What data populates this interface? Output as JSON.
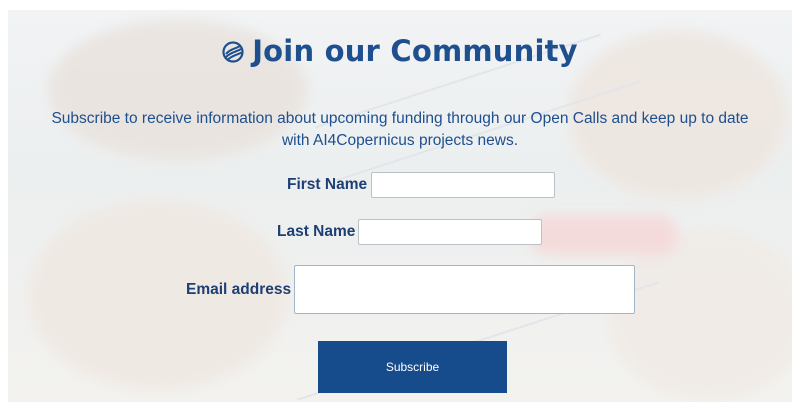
{
  "signup": {
    "title": "Join our Community",
    "description": "Subscribe to receive information about upcoming funding through our Open Calls and keep up to date with AI4Copernicus projects news.",
    "fields": {
      "first_name_label": "First Name",
      "first_name_value": "",
      "last_name_label": "Last Name",
      "last_name_value": "",
      "email_label": "Email address",
      "email_value": ""
    },
    "subscribe_label": "Subscribe"
  },
  "colors": {
    "accent": "#1e4f8f",
    "button": "#164b8c"
  },
  "icons": {
    "title_icon": "globe-swirl-icon"
  }
}
